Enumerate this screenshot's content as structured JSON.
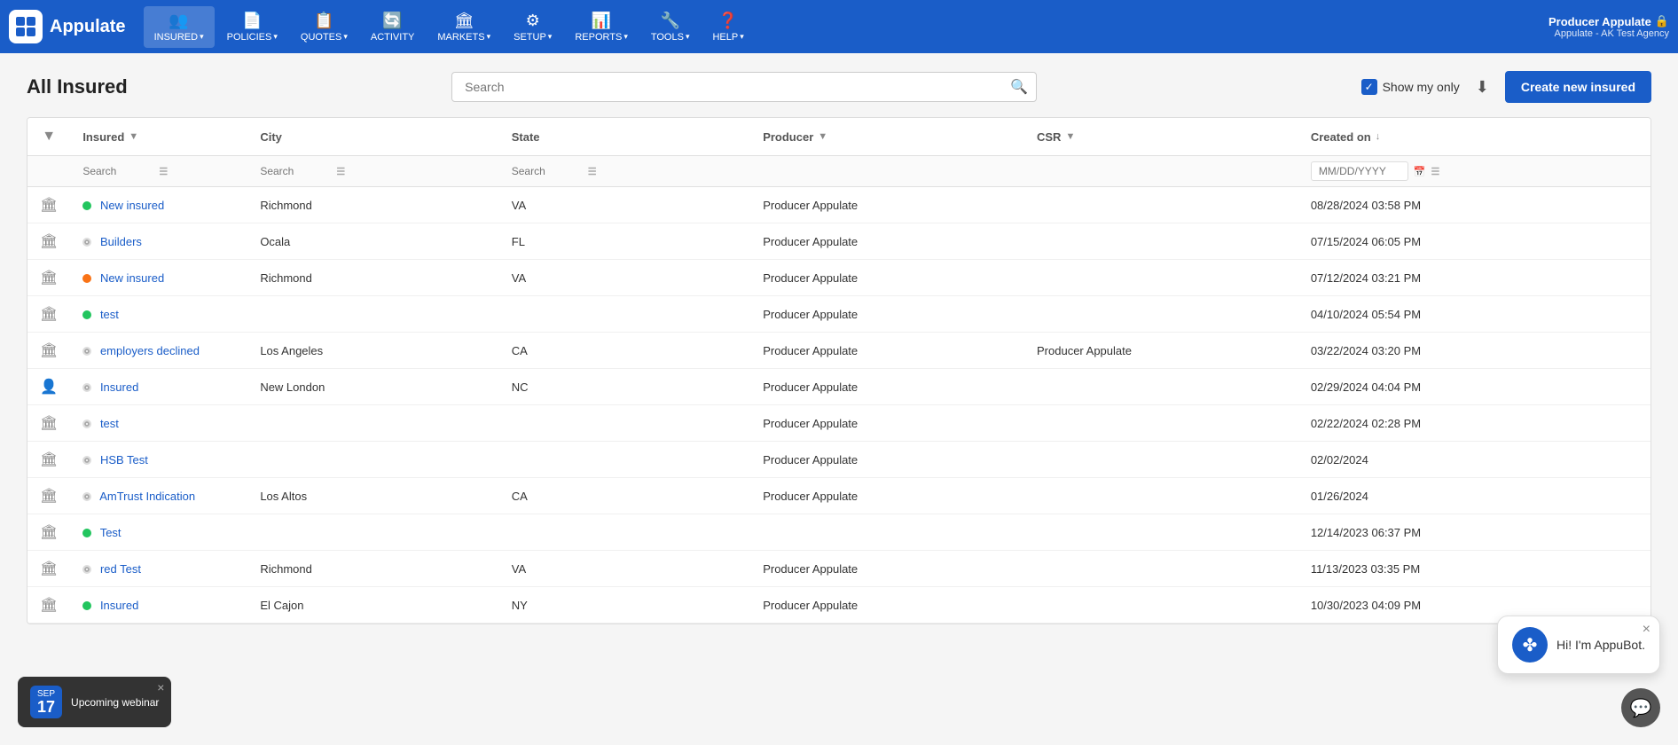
{
  "app": {
    "name": "Appulate",
    "logo_alt": "Appulate Logo"
  },
  "nav": {
    "items": [
      {
        "id": "insured",
        "icon": "👥",
        "label": "INSURED",
        "has_arrow": true,
        "active": true
      },
      {
        "id": "policies",
        "icon": "📄",
        "label": "POLICIES",
        "has_arrow": true
      },
      {
        "id": "quotes",
        "icon": "📋",
        "label": "QUOTES",
        "has_arrow": true
      },
      {
        "id": "activity",
        "icon": "🔄",
        "label": "ACTIVITY",
        "has_arrow": false
      },
      {
        "id": "markets",
        "icon": "🏛",
        "label": "MARKETS",
        "has_arrow": true
      },
      {
        "id": "setup",
        "icon": "⚙",
        "label": "SETUP",
        "has_arrow": true
      },
      {
        "id": "reports",
        "icon": "📊",
        "label": "REPORTS",
        "has_arrow": true
      },
      {
        "id": "tools",
        "icon": "🔧",
        "label": "TOOLS",
        "has_arrow": true
      },
      {
        "id": "help",
        "icon": "❓",
        "label": "HELP",
        "has_arrow": true
      }
    ],
    "user": {
      "name": "Producer Appulate",
      "agency": "Appulate - AK Test Agency",
      "lock_icon": "🔒"
    }
  },
  "page": {
    "title": "All Insured"
  },
  "toolbar": {
    "search_placeholder": "Search",
    "show_my_only_label": "Show my only",
    "download_label": "Download",
    "create_button_label": "Create new insured"
  },
  "table": {
    "columns": [
      {
        "id": "icon",
        "label": ""
      },
      {
        "id": "insured",
        "label": "Insured",
        "filterable": true
      },
      {
        "id": "city",
        "label": "City",
        "filterable": false
      },
      {
        "id": "state",
        "label": "State",
        "filterable": false
      },
      {
        "id": "producer",
        "label": "Producer",
        "filterable": true
      },
      {
        "id": "csr",
        "label": "CSR",
        "filterable": true
      },
      {
        "id": "created_on",
        "label": "Created on",
        "sort": "desc"
      }
    ],
    "rows": [
      {
        "icon": "building",
        "status": "green",
        "insured": "New insured",
        "city": "Richmond",
        "state": "VA",
        "producer": "Producer Appulate",
        "csr": "",
        "created_on": "08/28/2024 03:58 PM"
      },
      {
        "icon": "building",
        "status": "grey",
        "insured": "Builders",
        "city": "Ocala",
        "state": "FL",
        "producer": "Producer Appulate",
        "csr": "",
        "created_on": "07/15/2024 06:05 PM"
      },
      {
        "icon": "building",
        "status": "orange",
        "insured": "New insured",
        "city": "Richmond",
        "state": "VA",
        "producer": "Producer Appulate",
        "csr": "",
        "created_on": "07/12/2024 03:21 PM"
      },
      {
        "icon": "building",
        "status": "green",
        "insured": "test",
        "city": "",
        "state": "",
        "producer": "Producer Appulate",
        "csr": "",
        "created_on": "04/10/2024 05:54 PM"
      },
      {
        "icon": "building",
        "status": "grey",
        "insured": "employers declined",
        "city": "Los Angeles",
        "state": "CA",
        "producer": "Producer Appulate",
        "csr": "Producer Appulate",
        "created_on": "03/22/2024 03:20 PM"
      },
      {
        "icon": "person",
        "status": "grey",
        "insured": "Insured",
        "city": "New London",
        "state": "NC",
        "producer": "Producer Appulate",
        "csr": "",
        "created_on": "02/29/2024 04:04 PM"
      },
      {
        "icon": "building",
        "status": "grey",
        "insured": "test",
        "city": "",
        "state": "",
        "producer": "Producer Appulate",
        "csr": "",
        "created_on": "02/22/2024 02:28 PM"
      },
      {
        "icon": "building",
        "status": "grey",
        "insured": "HSB Test",
        "city": "",
        "state": "",
        "producer": "Producer Appulate",
        "csr": "",
        "created_on": "02/02/2024"
      },
      {
        "icon": "building",
        "status": "grey",
        "insured": "AmTrust Indication",
        "city": "Los Altos",
        "state": "CA",
        "producer": "Producer Appulate",
        "csr": "",
        "created_on": "01/26/2024"
      },
      {
        "icon": "building",
        "status": "green",
        "insured": "Test",
        "city": "",
        "state": "",
        "producer": "",
        "csr": "",
        "created_on": "12/14/2023 06:37 PM"
      },
      {
        "icon": "building",
        "status": "grey",
        "insured": "red Test",
        "city": "Richmond",
        "state": "VA",
        "producer": "Producer Appulate",
        "csr": "",
        "created_on": "11/13/2023 03:35 PM"
      },
      {
        "icon": "building",
        "status": "green",
        "insured": "Insured",
        "city": "El Cajon",
        "state": "NY",
        "producer": "Producer Appulate",
        "csr": "",
        "created_on": "10/30/2023 04:09 PM"
      }
    ]
  },
  "appubot": {
    "message": "Hi! I'm AppuBot.",
    "close_label": "×"
  },
  "webinar": {
    "month": "SEP",
    "day": "17",
    "label": "Upcoming webinar",
    "close_label": "×"
  }
}
